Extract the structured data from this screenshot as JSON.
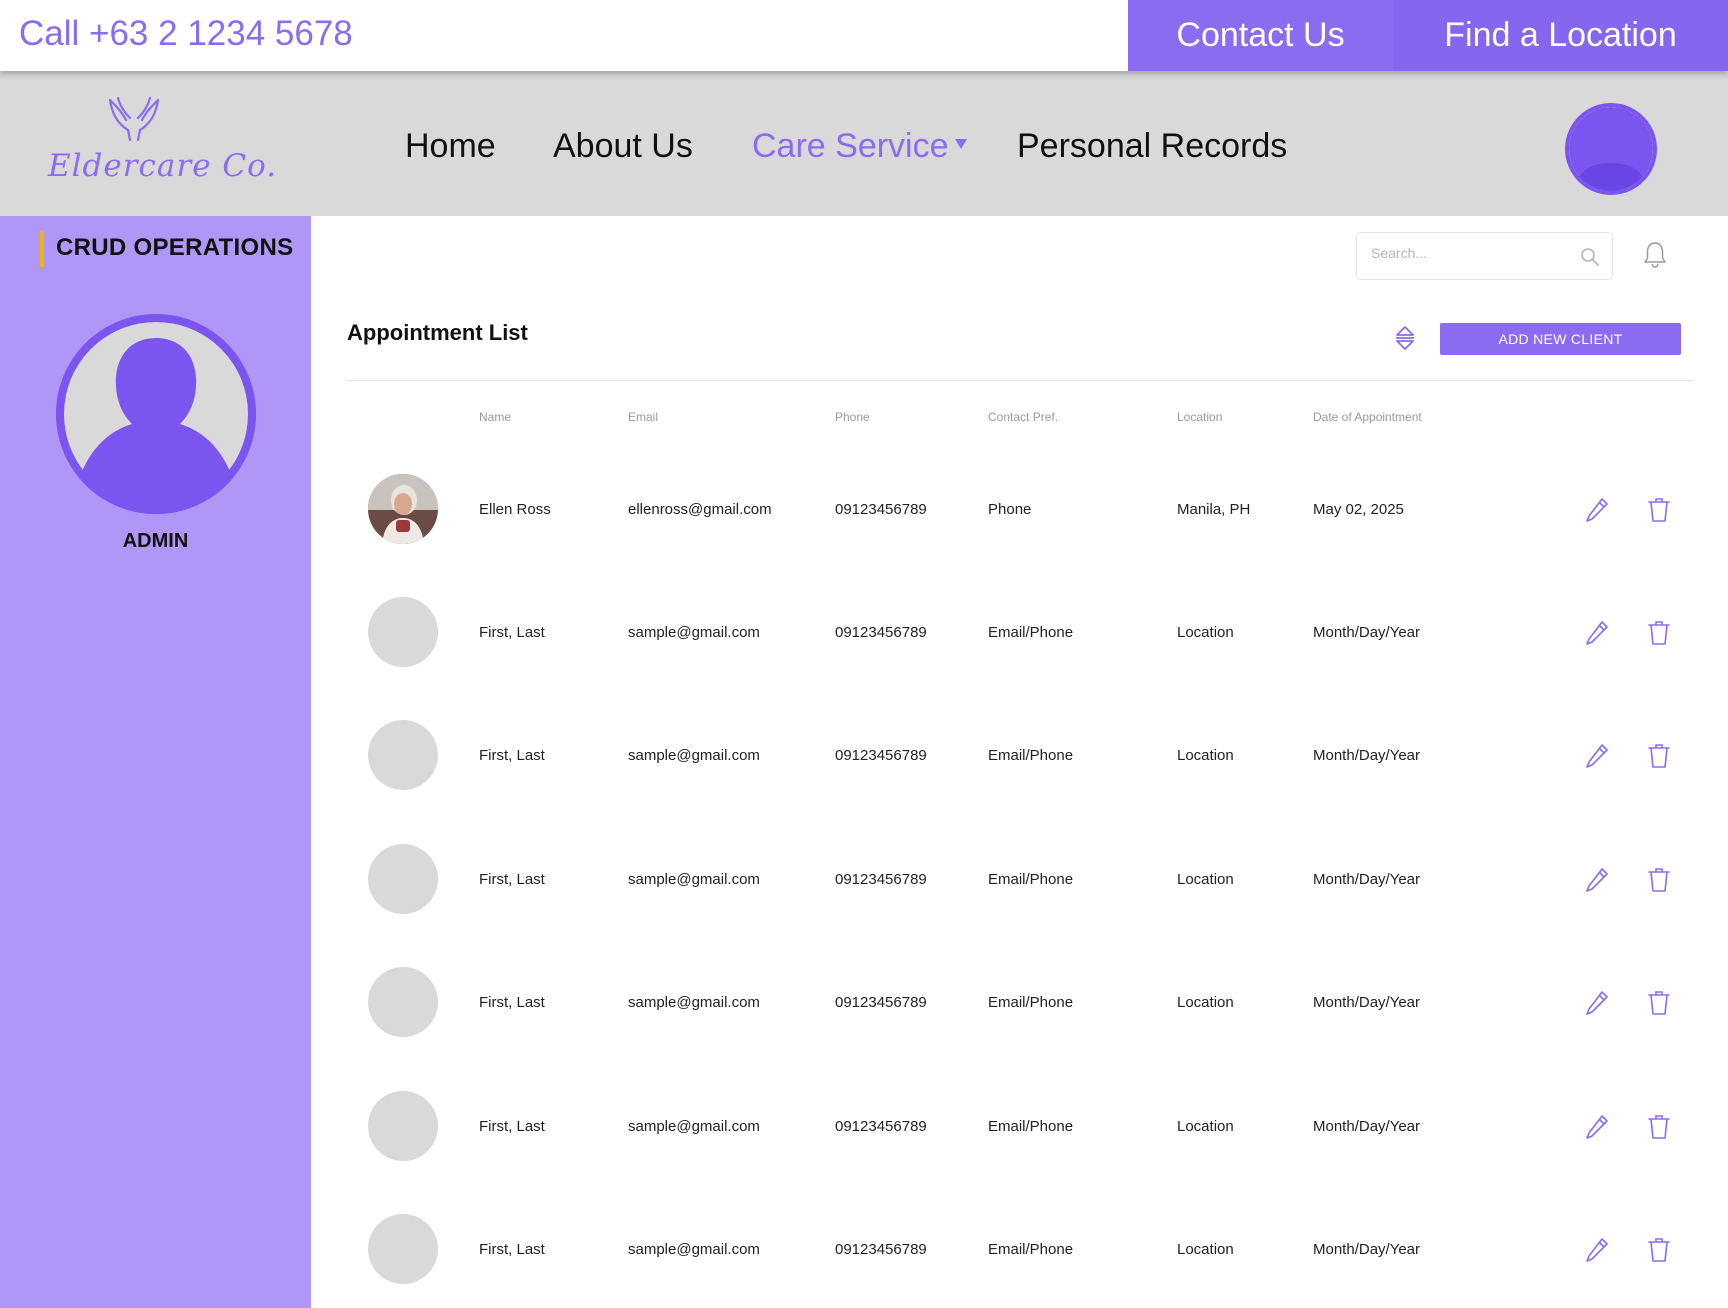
{
  "topbar": {
    "phone": "Call +63 2 1234 5678",
    "contact_label": "Contact Us",
    "find_label": "Find a Location"
  },
  "nav": {
    "brand": "Eldercare Co.",
    "items": [
      {
        "label": "Home"
      },
      {
        "label": "About Us"
      },
      {
        "label": "Care Service"
      },
      {
        "label": "Personal Records"
      }
    ],
    "active_item": "Care Service"
  },
  "sidebar": {
    "heading": "CRUD OPERATIONS",
    "role": "ADMIN"
  },
  "main": {
    "search_placeholder": "Search...",
    "title": "Appointment List",
    "add_button": "ADD NEW CLIENT",
    "columns": [
      "Name",
      "Email",
      "Phone",
      "Contact Pref.",
      "Location",
      "Date of Appointment"
    ],
    "rows": [
      {
        "name": "Ellen Ross",
        "email": "ellenross@gmail.com",
        "phone": "09123456789",
        "pref": "Phone",
        "location": "Manila, PH",
        "date": "May 02, 2025",
        "has_photo": true
      },
      {
        "name": "First, Last",
        "email": "sample@gmail.com",
        "phone": "09123456789",
        "pref": "Email/Phone",
        "location": "Location",
        "date": "Month/Day/Year",
        "has_photo": false
      },
      {
        "name": "First, Last",
        "email": "sample@gmail.com",
        "phone": "09123456789",
        "pref": "Email/Phone",
        "location": "Location",
        "date": "Month/Day/Year",
        "has_photo": false
      },
      {
        "name": "First, Last",
        "email": "sample@gmail.com",
        "phone": "09123456789",
        "pref": "Email/Phone",
        "location": "Location",
        "date": "Month/Day/Year",
        "has_photo": false
      },
      {
        "name": "First, Last",
        "email": "sample@gmail.com",
        "phone": "09123456789",
        "pref": "Email/Phone",
        "location": "Location",
        "date": "Month/Day/Year",
        "has_photo": false
      },
      {
        "name": "First, Last",
        "email": "sample@gmail.com",
        "phone": "09123456789",
        "pref": "Email/Phone",
        "location": "Location",
        "date": "Month/Day/Year",
        "has_photo": false
      },
      {
        "name": "First, Last",
        "email": "sample@gmail.com",
        "phone": "09123456789",
        "pref": "Email/Phone",
        "location": "Location",
        "date": "Month/Day/Year",
        "has_photo": false
      }
    ]
  },
  "colors": {
    "accent": "#8b6cf0",
    "sidebar": "#af96f7",
    "nav_bg": "#d9d9d9",
    "highlight": "#f5b400"
  },
  "icons": [
    "hands-logo-icon",
    "user-avatar-icon",
    "search-icon",
    "bell-icon",
    "sort-icon",
    "pencil-icon",
    "trash-icon",
    "caret-down-icon"
  ]
}
